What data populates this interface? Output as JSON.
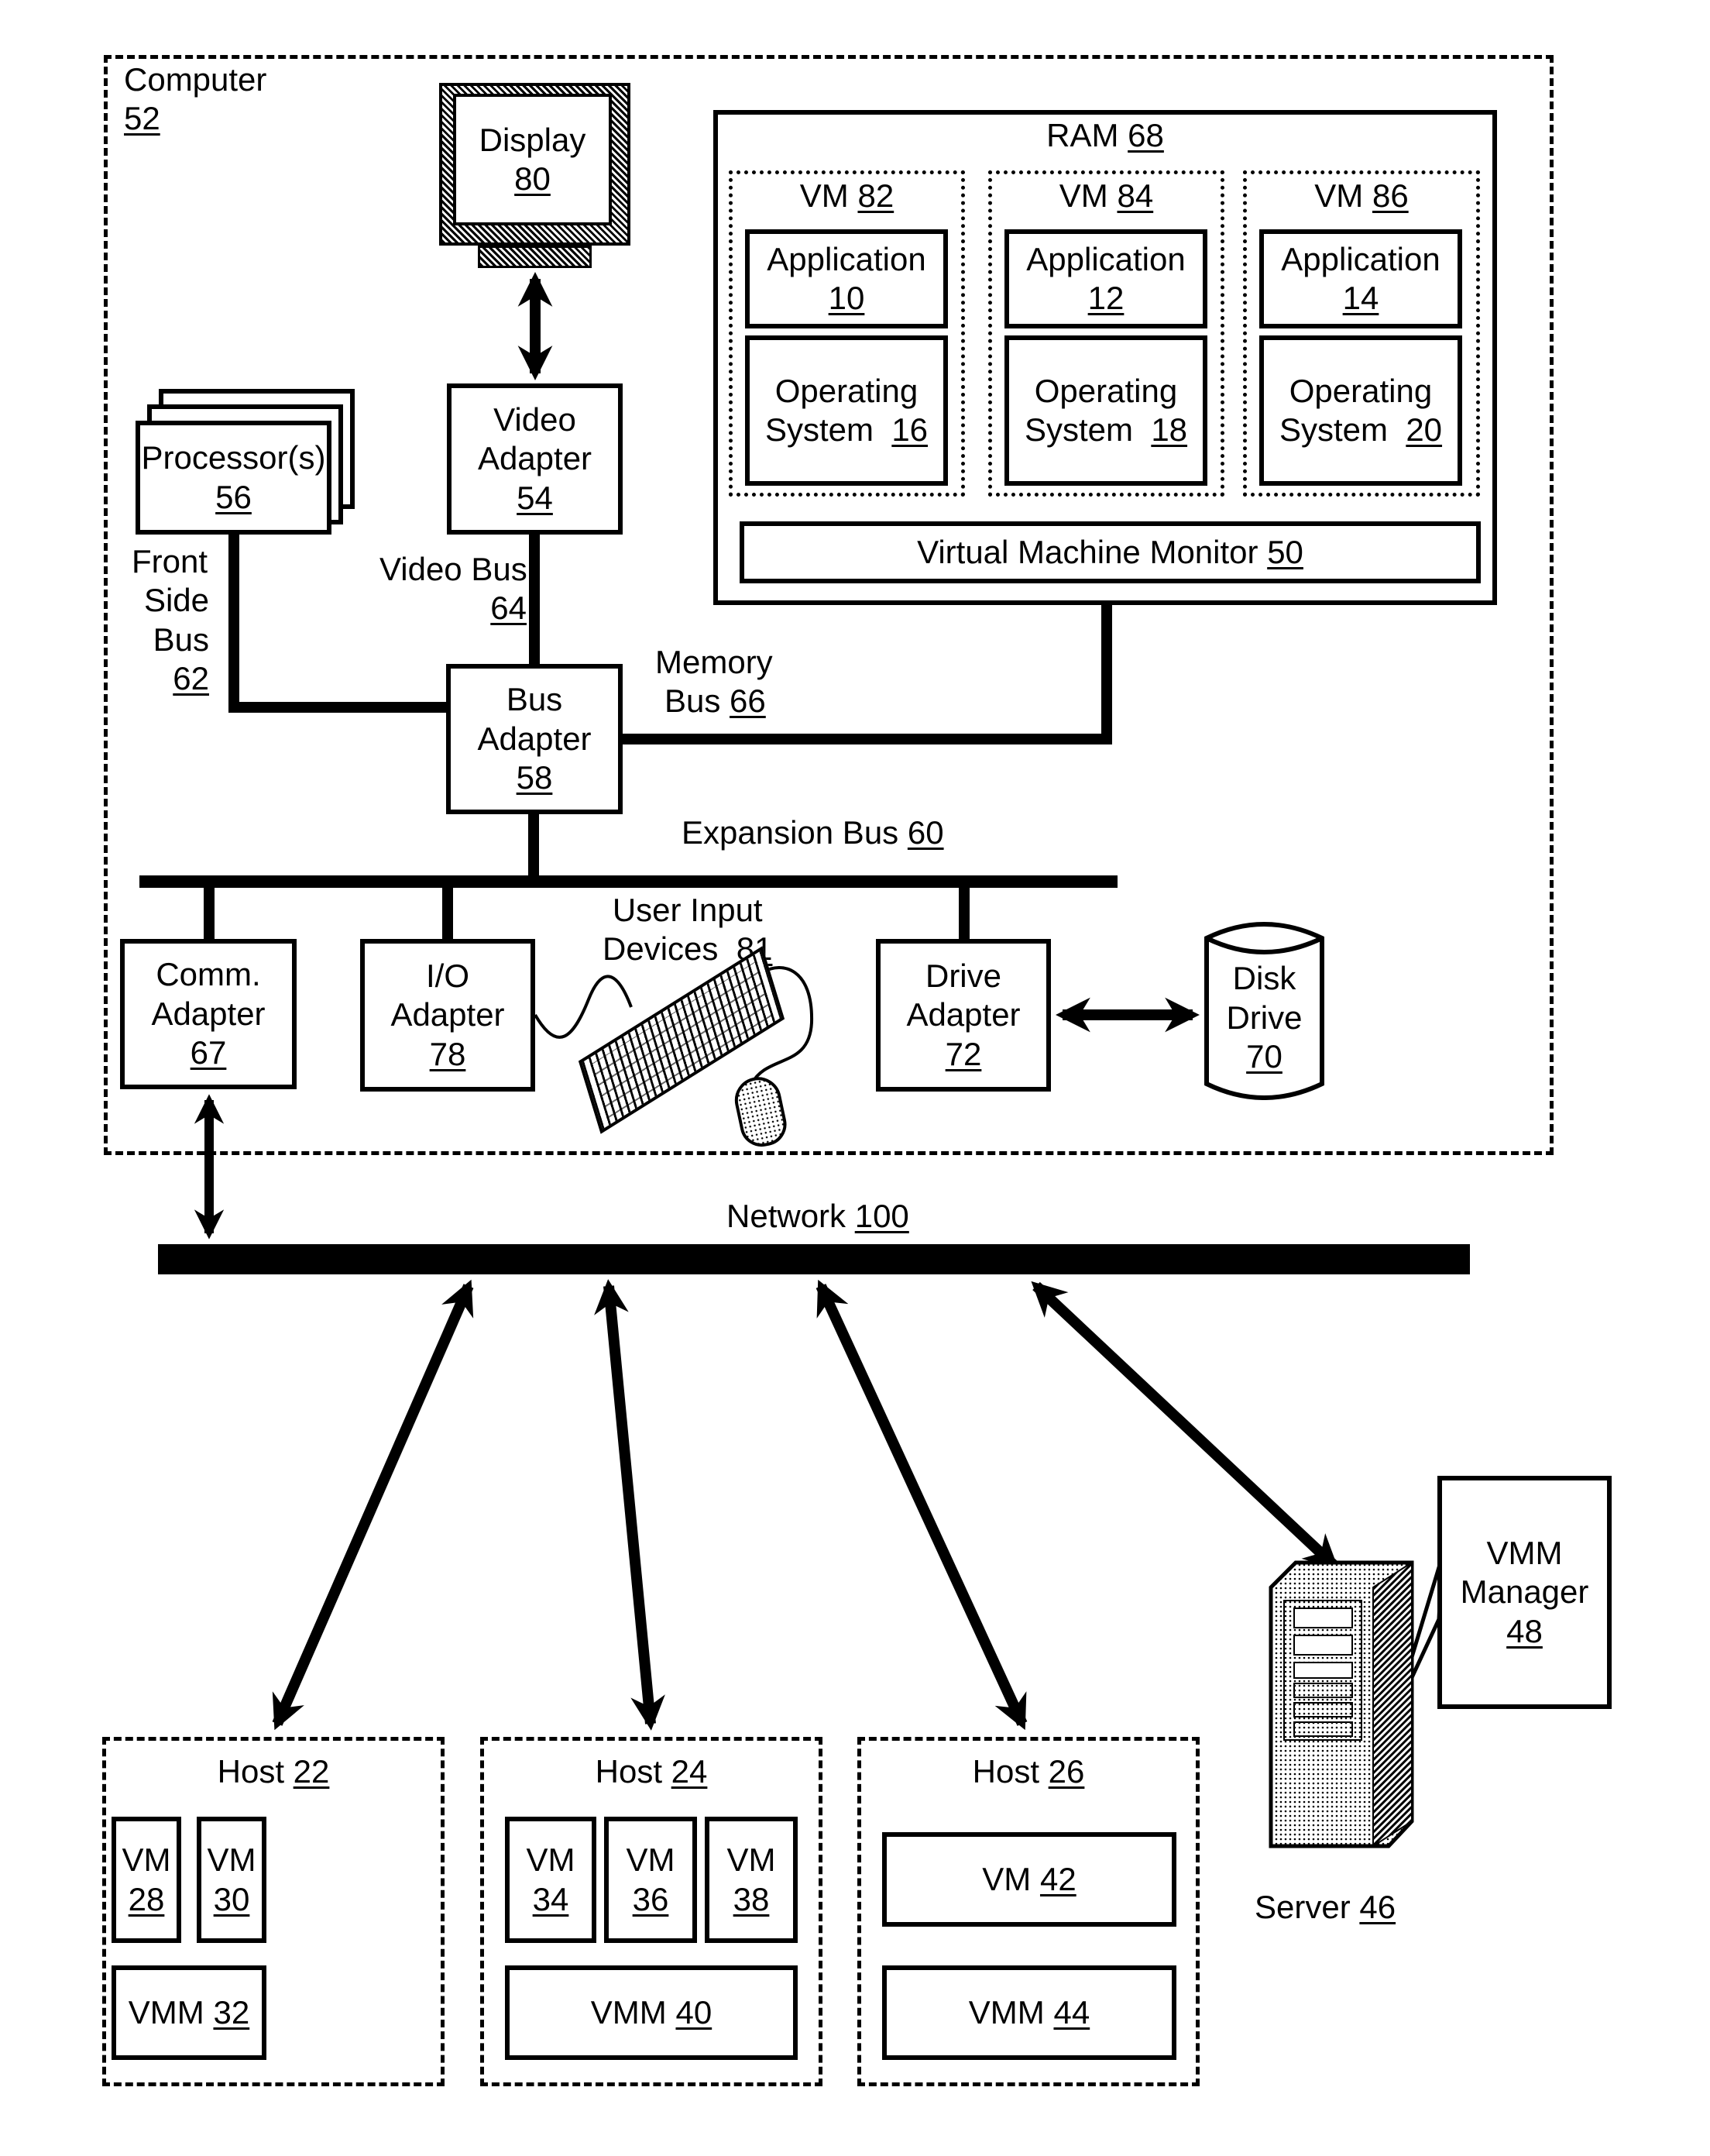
{
  "computer": {
    "label": "Computer",
    "ref": "52"
  },
  "display": {
    "label": "Display",
    "ref": "80"
  },
  "video_adapter": {
    "line1": "Video",
    "line2": "Adapter",
    "ref": "54"
  },
  "processors": {
    "label": "Processor(s)",
    "ref": "56"
  },
  "ram": {
    "label": "RAM",
    "ref": "68"
  },
  "vms": [
    {
      "label": "VM",
      "ref": "82",
      "app_label": "Application",
      "app_ref": "10",
      "os_line1": "Operating",
      "os_line2": "System",
      "os_ref": "16"
    },
    {
      "label": "VM",
      "ref": "84",
      "app_label": "Application",
      "app_ref": "12",
      "os_line1": "Operating",
      "os_line2": "System",
      "os_ref": "18"
    },
    {
      "label": "VM",
      "ref": "86",
      "app_label": "Application",
      "app_ref": "14",
      "os_line1": "Operating",
      "os_line2": "System",
      "os_ref": "20"
    }
  ],
  "vmm": {
    "label": "Virtual Machine Monitor",
    "ref": "50"
  },
  "front_side_bus": {
    "line1": "Front",
    "line2": "Side",
    "line3": "Bus",
    "ref": "62"
  },
  "video_bus": {
    "label": "Video Bus",
    "ref": "64"
  },
  "memory_bus": {
    "line1": "Memory",
    "line2": "Bus",
    "ref": "66"
  },
  "bus_adapter": {
    "line1": "Bus",
    "line2": "Adapter",
    "ref": "58"
  },
  "expansion_bus": {
    "label": "Expansion Bus",
    "ref": "60"
  },
  "comm_adapter": {
    "line1": "Comm.",
    "line2": "Adapter",
    "ref": "67"
  },
  "io_adapter": {
    "line1": "I/O",
    "line2": "Adapter",
    "ref": "78"
  },
  "user_input": {
    "line1": "User Input",
    "line2": "Devices",
    "ref": "81"
  },
  "drive_adapter": {
    "line1": "Drive",
    "line2": "Adapter",
    "ref": "72"
  },
  "disk_drive": {
    "line1": "Disk",
    "line2": "Drive",
    "ref": "70"
  },
  "network": {
    "label": "Network",
    "ref": "100"
  },
  "hosts": [
    {
      "label": "Host",
      "ref": "22",
      "vms": [
        {
          "label": "VM",
          "ref": "28"
        },
        {
          "label": "VM",
          "ref": "30"
        }
      ],
      "vmm_label": "VMM",
      "vmm_ref": "32"
    },
    {
      "label": "Host",
      "ref": "24",
      "vms": [
        {
          "label": "VM",
          "ref": "34"
        },
        {
          "label": "VM",
          "ref": "36"
        },
        {
          "label": "VM",
          "ref": "38"
        }
      ],
      "vmm_label": "VMM",
      "vmm_ref": "40"
    },
    {
      "label": "Host",
      "ref": "26",
      "vms": [
        {
          "label": "VM",
          "ref": "42"
        }
      ],
      "vmm_label": "VMM",
      "vmm_ref": "44"
    }
  ],
  "server": {
    "label": "Server",
    "ref": "46"
  },
  "vmm_manager": {
    "line1": "VMM",
    "line2": "Manager",
    "ref": "48"
  }
}
